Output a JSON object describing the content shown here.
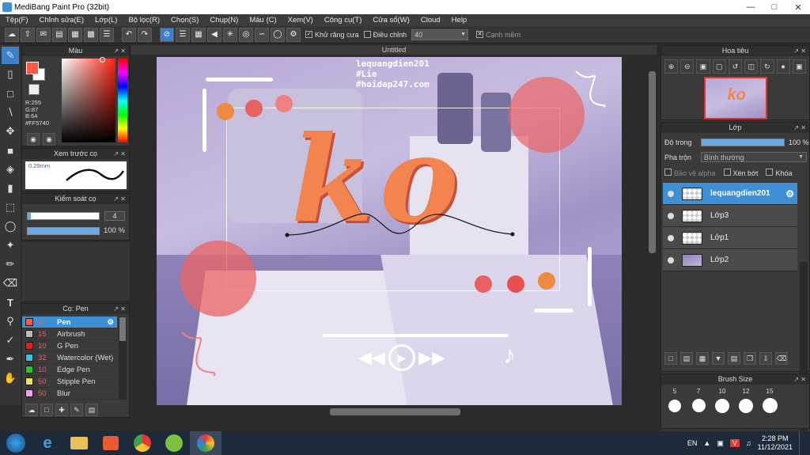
{
  "window": {
    "title": "MediBang Paint Pro (32bit)"
  },
  "menu": [
    "Tệp(F)",
    "Chỉnh sửa(E)",
    "Lớp(L)",
    "Bộ lọc(R)",
    "Chọn(S)",
    "Chụp(N)",
    "Màu (C)",
    "Xem(V)",
    "Công cụ(T)",
    "Cửa sổ(W)",
    "Cloud",
    "Help"
  ],
  "toolbar": {
    "antialias_label": "Khử răng cưa",
    "adjust_label": "Điều chỉnh",
    "adjust_value": "40",
    "edge_label": "Cạnh mềm"
  },
  "color_panel": {
    "title": "Màu",
    "r": "R:255",
    "g": "G:87",
    "b": "B:64",
    "hex": "#FF5740",
    "fg_color": "#FF5740"
  },
  "brush_preview": {
    "title": "Xem trước cọ",
    "size": "0.29mm"
  },
  "brush_control": {
    "title": "Kiểm soát cọ",
    "size_value": "4",
    "opacity_value": "100 %"
  },
  "brush_panel": {
    "title": "Cọ: Pen",
    "items": [
      {
        "size": "4",
        "name": "Pen",
        "color": "#FF5740"
      },
      {
        "size": "15",
        "name": "Airbrush",
        "color": "#bbbbbb"
      },
      {
        "size": "10",
        "name": "G Pen",
        "color": "#e02020"
      },
      {
        "size": "32",
        "name": "Watercolor (Wet)",
        "color": "#40c0e0"
      },
      {
        "size": "10",
        "name": "Edge Pen",
        "color": "#30c030"
      },
      {
        "size": "50",
        "name": "Stipple Pen",
        "color": "#f0e060"
      },
      {
        "size": "50",
        "name": "Blur",
        "color": "#f0a0f0"
      }
    ]
  },
  "canvas": {
    "title": "Untitled",
    "watermark_lines": [
      "lequangdien201",
      "#Lie",
      "#hoidap247.com"
    ],
    "artwork_text": "ko"
  },
  "navigator": {
    "title": "Hoa tiêu"
  },
  "layer_panel": {
    "title": "Lớp",
    "opacity_label": "Độ trong",
    "opacity_value": "100 %",
    "opacity_fraction": 1.0,
    "blend_label": "Pha trộn",
    "blend_value": "Bình thường",
    "protect_alpha": "Bảo vệ alpha",
    "clipping": "Xén bớt",
    "lock": "Khóa",
    "layers": [
      {
        "name": "lequangdien201",
        "selected": true
      },
      {
        "name": "Lớp3",
        "selected": false
      },
      {
        "name": "Lớp1",
        "selected": false
      },
      {
        "name": "Lớp2",
        "selected": false
      }
    ]
  },
  "brush_size_panel": {
    "title": "Brush Size",
    "sizes": [
      "5",
      "7",
      "10",
      "12",
      "15"
    ]
  },
  "taskbar": {
    "lang": "EN",
    "time": "2:28 PM",
    "date": "11/12/2021"
  }
}
